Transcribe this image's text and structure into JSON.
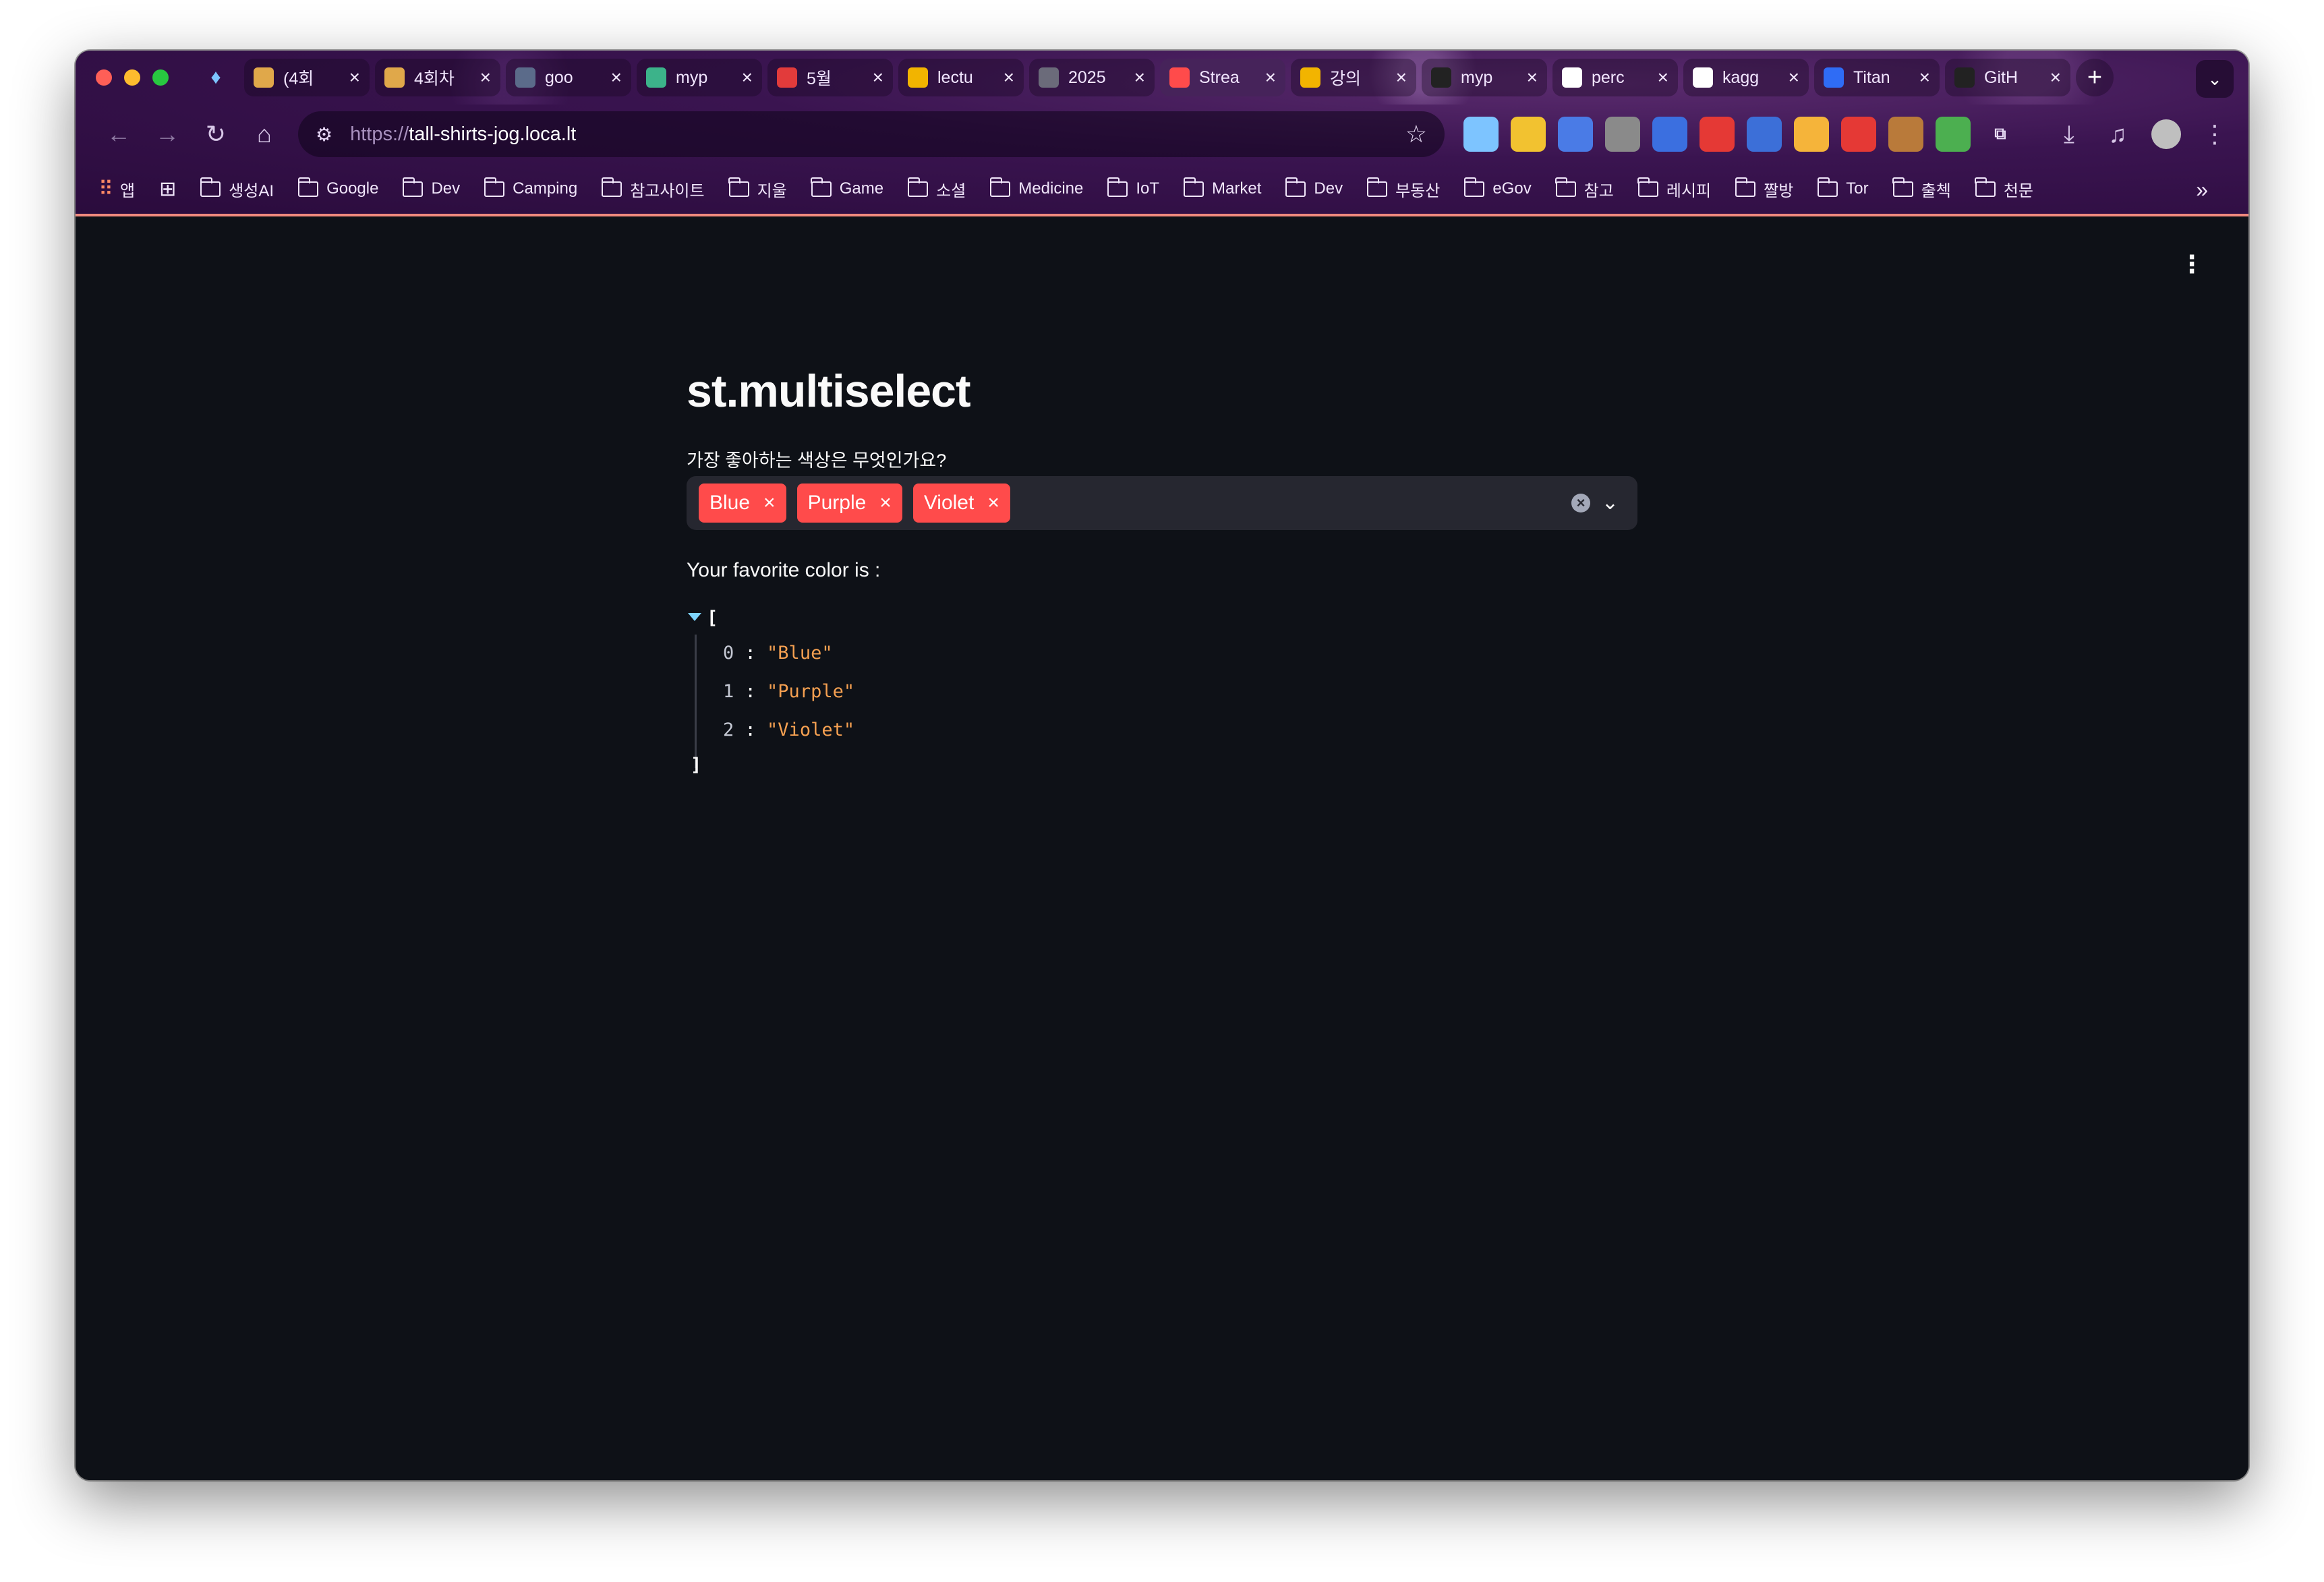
{
  "browser": {
    "tabs": [
      {
        "title": "(4회",
        "favicon": "box-icon",
        "color": "#e0a84a"
      },
      {
        "title": "4회차",
        "favicon": "box-icon",
        "color": "#e0a84a"
      },
      {
        "title": "goo",
        "favicon": "monitor-icon",
        "color": "#5b6b8a"
      },
      {
        "title": "myp",
        "favicon": "v-icon",
        "color": "#3cb38a"
      },
      {
        "title": "5월",
        "favicon": "hundred-icon",
        "color": "#e23b3b"
      },
      {
        "title": "lectu",
        "favicon": "drive-icon",
        "color": "#f2b400"
      },
      {
        "title": "2025",
        "favicon": "infinity-icon",
        "color": "#6b6b7a"
      },
      {
        "title": "Strea",
        "favicon": "crown-icon",
        "color": "#ff4b4b"
      },
      {
        "title": "강의",
        "favicon": "drive-icon",
        "color": "#f2b400"
      },
      {
        "title": "myp",
        "favicon": "github-icon",
        "color": "#222222"
      },
      {
        "title": "perc",
        "favicon": "google-icon",
        "color": "#ffffff"
      },
      {
        "title": "kagg",
        "favicon": "google-icon",
        "color": "#ffffff"
      },
      {
        "title": "Titan",
        "favicon": "k-icon",
        "color": "#2f6cf5"
      },
      {
        "title": "GitH",
        "favicon": "github-icon",
        "color": "#222222"
      }
    ],
    "active_tab_index": 7,
    "url_scheme": "https://",
    "url_host": "tall-shirts-jog.loca.lt",
    "bookmarks_apps_label": "앱",
    "bookmarks": [
      "생성AI",
      "Google",
      "Dev",
      "Camping",
      "참고사이트",
      "지울",
      "Game",
      "소셜",
      "Medicine",
      "IoT",
      "Market",
      "Dev",
      "부동산",
      "eGov",
      "참고",
      "레시피",
      "짤방",
      "Tor",
      "출첵",
      "천문"
    ],
    "extensions": [
      {
        "name": "gem-extension-icon",
        "color": "#7dc4ff"
      },
      {
        "name": "note-extension-icon",
        "color": "#f2c230"
      },
      {
        "name": "translate-extension-icon",
        "color": "#4a7be6"
      },
      {
        "name": "shield-extension-icon",
        "color": "#8a8a8a"
      },
      {
        "name": "search-extension-icon",
        "color": "#3b6fe0"
      },
      {
        "name": "bolt-extension-icon",
        "color": "#e53935"
      },
      {
        "name": "s-extension-icon",
        "color": "#3c6fd8"
      },
      {
        "name": "circle-extension-icon",
        "color": "#f5b43a"
      },
      {
        "name": "play-extension-icon",
        "color": "#e53935"
      },
      {
        "name": "cookie-extension-icon",
        "color": "#b97a3a"
      },
      {
        "name": "globe-extension-icon",
        "color": "#4caf50"
      }
    ]
  },
  "app": {
    "title": "st.multiselect",
    "multiselect_label": "가장 좋아하는 색상은 무엇인가요?",
    "selected_options": [
      "Blue",
      "Purple",
      "Violet"
    ],
    "output_label": "Your favorite color is :",
    "json_output": [
      {
        "index": "0",
        "value": "\"Blue\""
      },
      {
        "index": "1",
        "value": "\"Purple\""
      },
      {
        "index": "2",
        "value": "\"Violet\""
      }
    ],
    "json_open": "[",
    "json_close": "]",
    "accent_color": "#ff4b4b",
    "background_color": "#0e1117"
  }
}
